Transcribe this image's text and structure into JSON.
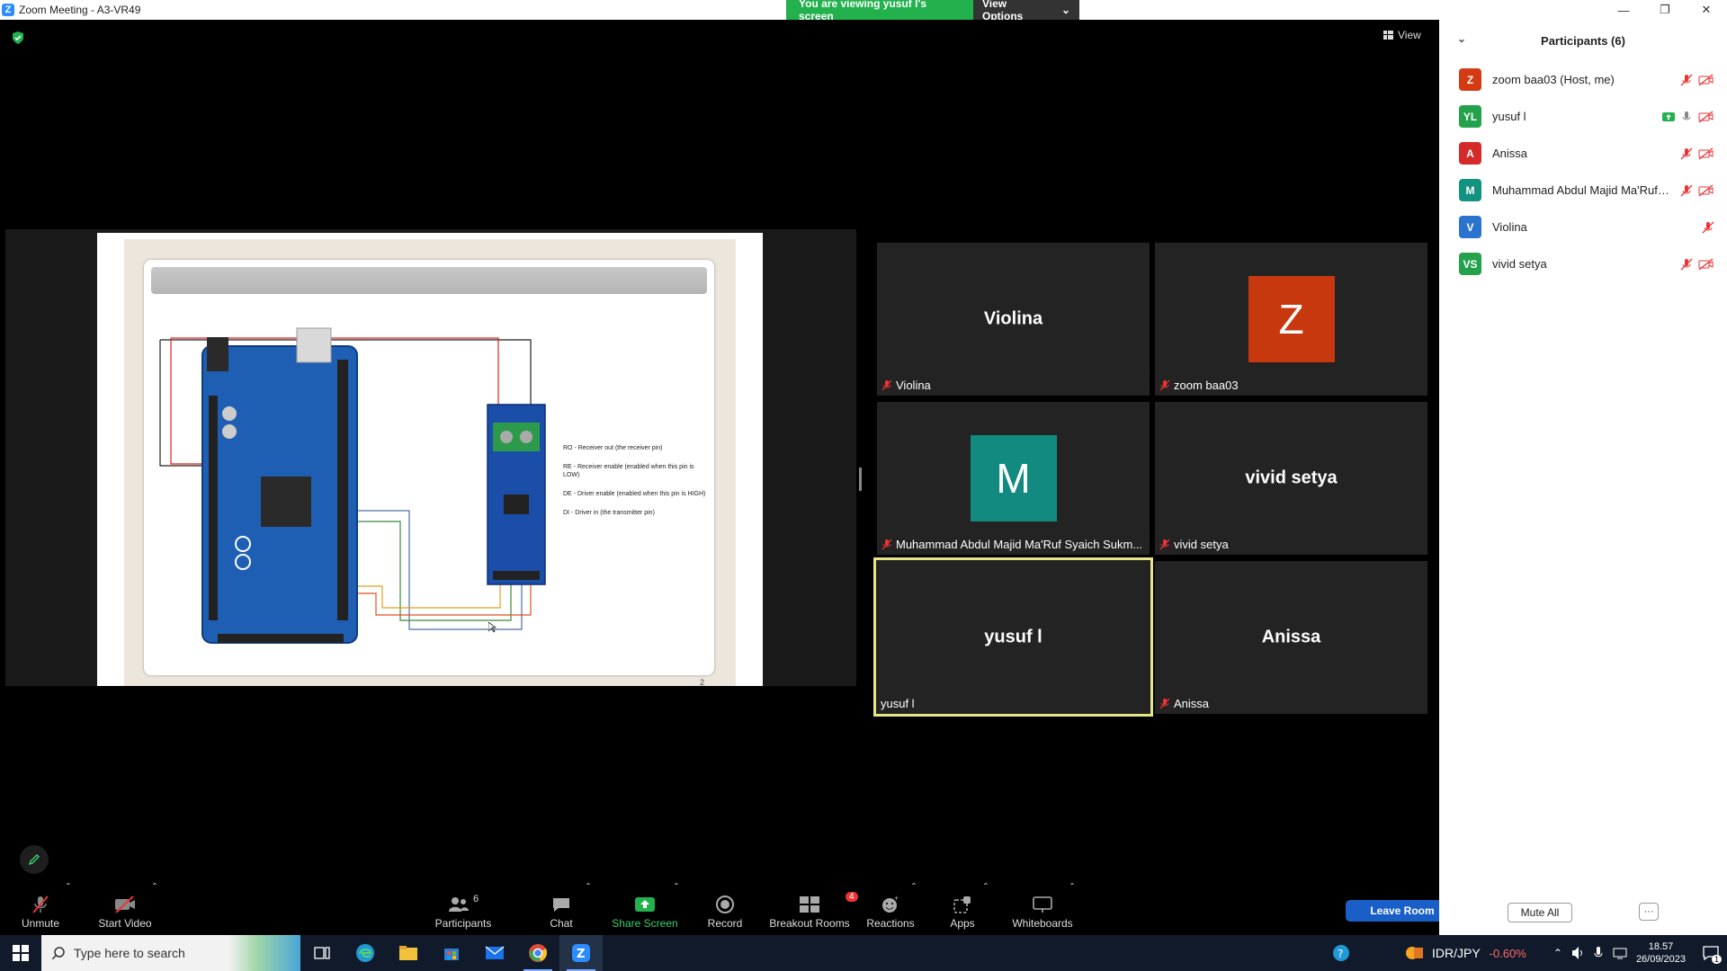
{
  "window": {
    "title": "Zoom Meeting - A3-VR49"
  },
  "viewing_banner": {
    "text": "You are viewing yusuf l's screen",
    "options_label": "View Options"
  },
  "view_button": "View",
  "slide": {
    "notes": [
      "RO - Receiver out (the receiver pin)",
      "RE - Receiver enable (enabled when this pin is LOW)",
      "DE - Driver enable (enabled when this pin is HIGH)",
      "DI - Driver in (the transmitter pin)"
    ],
    "page_number": "2"
  },
  "tiles": [
    {
      "display": "Violina",
      "label": "Violina",
      "muted": true
    },
    {
      "display": "Z",
      "label": "zoom baa03",
      "muted": true,
      "avatar_color": "#c8380f"
    },
    {
      "display": "M",
      "label": "Muhammad Abdul Majid Ma'Ruf Syaich Sukm...",
      "muted": true,
      "avatar_color": "#138a80"
    },
    {
      "display": "vivid setya",
      "label": "vivid setya",
      "muted": true
    },
    {
      "display": "yusuf l",
      "label": "yusuf l",
      "muted": false
    },
    {
      "display": "Anissa",
      "label": "Anissa",
      "muted": true
    }
  ],
  "toolbar": {
    "unmute": "Unmute",
    "start_video": "Start Video",
    "participants": "Participants",
    "participants_count": "6",
    "chat": "Chat",
    "share_screen": "Share Screen",
    "record": "Record",
    "breakout_rooms": "Breakout Rooms",
    "breakout_badge": "4",
    "reactions": "Reactions",
    "apps": "Apps",
    "whiteboards": "Whiteboards",
    "leave": "Leave Room"
  },
  "panel": {
    "title": "Participants (6)",
    "participants": [
      {
        "initials": "Z",
        "name": "zoom baa03 (Host, me)",
        "color": "#d43b13"
      },
      {
        "initials": "YL",
        "name": "yusuf l",
        "color": "#23a14b"
      },
      {
        "initials": "A",
        "name": "Anissa",
        "color": "#d42a2a"
      },
      {
        "initials": "M",
        "name": "Muhammad Abdul Majid Ma'Ruf Syaich Sukm...",
        "color": "#11937f"
      },
      {
        "initials": "V",
        "name": "Violina",
        "color": "#2a73cf"
      },
      {
        "initials": "VS",
        "name": "vivid setya",
        "color": "#23a14b"
      }
    ],
    "mute_all": "Mute All",
    "more": "···"
  },
  "taskbar": {
    "search_placeholder": "Type here to search",
    "ticker_pair": "IDR/JPY",
    "ticker_change": "-0.60%",
    "time": "18.57",
    "date": "26/09/2023",
    "notification_count": "1"
  }
}
